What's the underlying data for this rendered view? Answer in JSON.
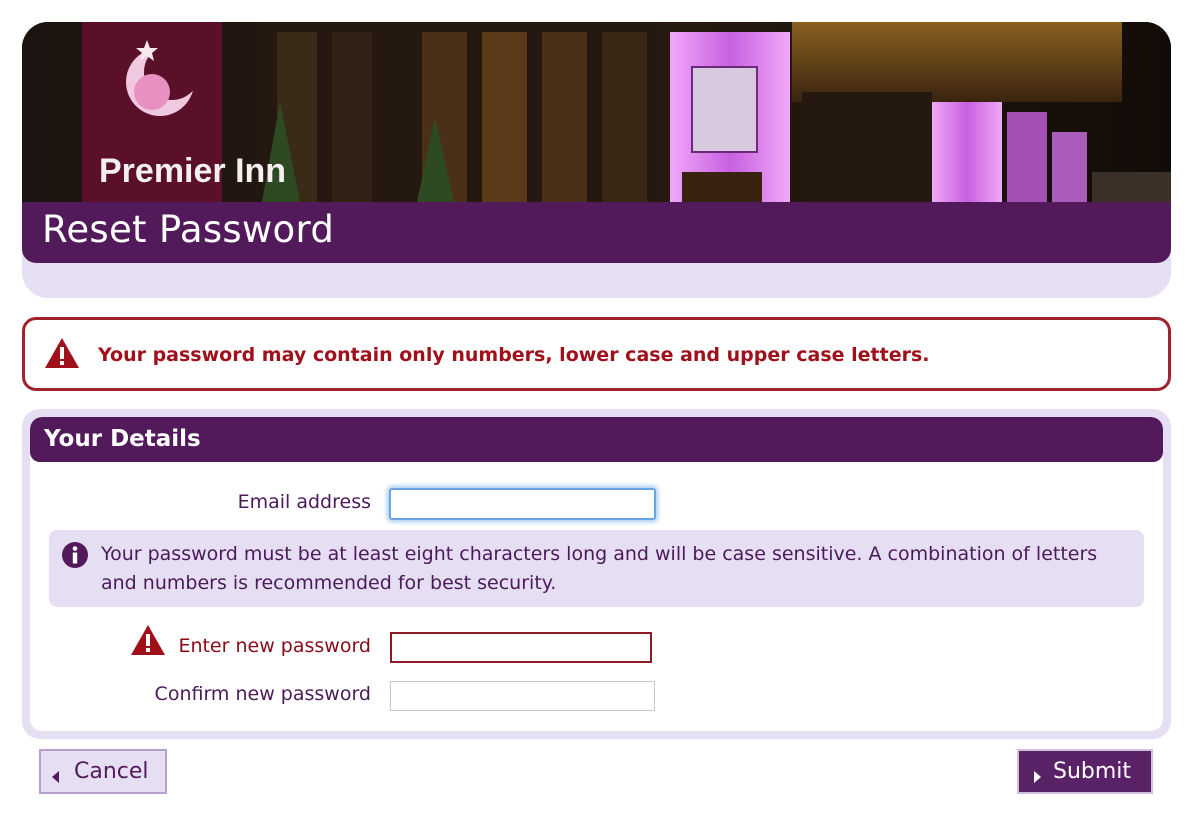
{
  "header": {
    "brand_logo_text": "Premier Inn",
    "title": "Reset Password"
  },
  "alert": {
    "message": "Your password may contain only numbers, lower case and upper case letters."
  },
  "details": {
    "title": "Your Details",
    "email_label": "Email address",
    "email_value": "",
    "info_text": "Your password must be at least eight characters long and will be case sensitive. A combination of letters and numbers is recommended for best security.",
    "new_password_label": "Enter new password",
    "new_password_value": "",
    "confirm_password_label": "Confirm new password",
    "confirm_password_value": ""
  },
  "actions": {
    "cancel_label": "Cancel",
    "submit_label": "Submit"
  },
  "colors": {
    "brand_purple": "#521a5b",
    "panel_lavender": "#e6def2",
    "error_red": "#a0101a",
    "focus_blue": "#6aa6e6"
  },
  "icons": [
    "warning-icon",
    "info-icon",
    "caret-left-icon",
    "caret-right-icon"
  ]
}
